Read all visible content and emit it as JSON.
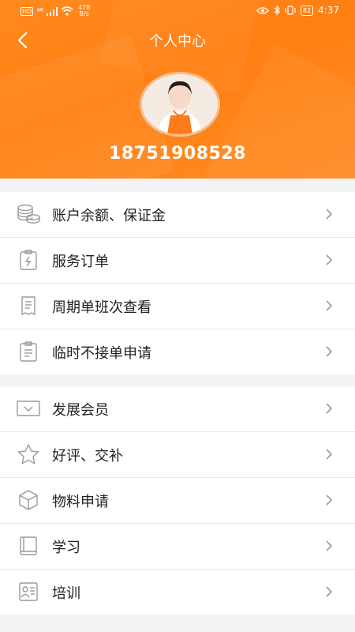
{
  "status_bar": {
    "hd": "HD",
    "signal": "⁴⁶",
    "speed_value": "478",
    "speed_unit": "B/s",
    "battery": "82",
    "time": "4:37"
  },
  "nav": {
    "title": "个人中心"
  },
  "profile": {
    "phone": "18751908528"
  },
  "menu_group_1": [
    {
      "label": "账户余额、保证金"
    },
    {
      "label": "服务订单"
    },
    {
      "label": "周期单班次查看"
    },
    {
      "label": "临时不接单申请"
    }
  ],
  "menu_group_2": [
    {
      "label": "发展会员"
    },
    {
      "label": "好评、交补"
    },
    {
      "label": "物料申请"
    },
    {
      "label": "学习"
    },
    {
      "label": "培训"
    }
  ],
  "colors": {
    "header_orange": "#ff8218",
    "icon_gray": "#9a9a9a"
  }
}
